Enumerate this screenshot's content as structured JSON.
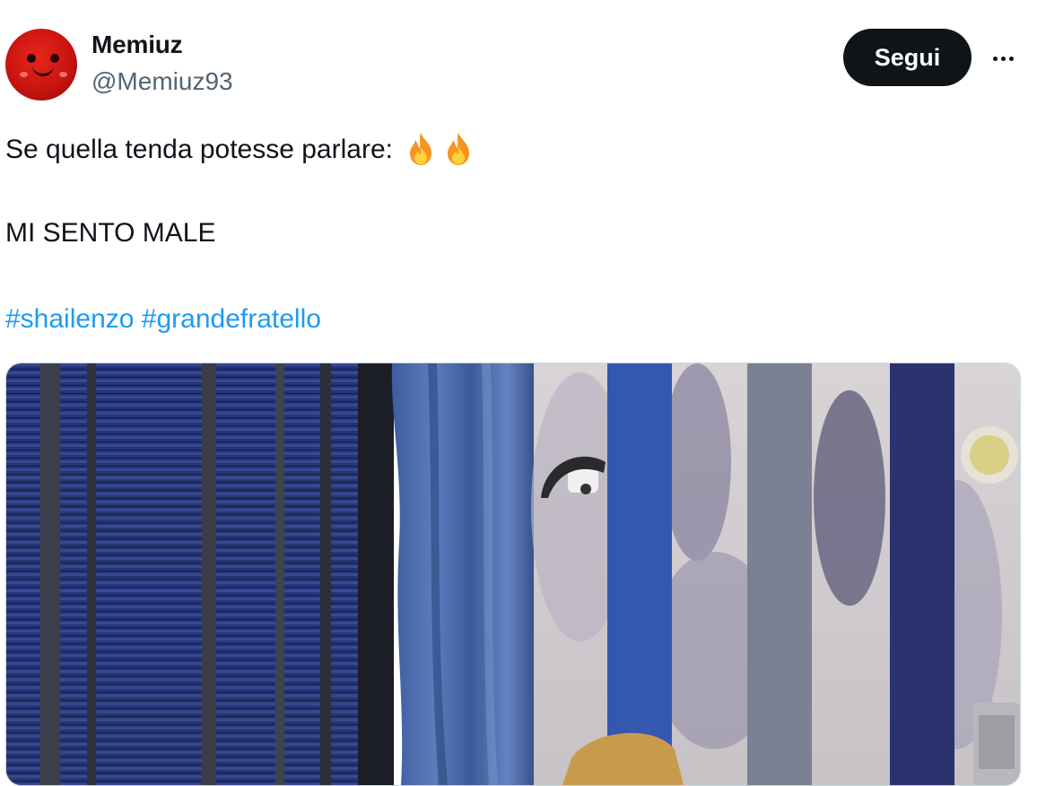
{
  "author": {
    "display_name": "Memiuz",
    "handle": "@Memiuz93",
    "avatar_icon": "red-smiley-avatar"
  },
  "actions": {
    "follow_label": "Segui",
    "more_icon": "more-horizontal-icon"
  },
  "tweet": {
    "line1": "Se quella tenda potesse parlare:",
    "emojis": [
      "fire-emoji",
      "fire-emoji"
    ],
    "line2": "MI SENTO MALE",
    "hashtags": [
      "#shailenzo",
      "#grandefratello"
    ]
  },
  "media": {
    "type": "video-frame",
    "icon": "video-thumbnail"
  },
  "colors": {
    "text": "#0f1419",
    "secondary": "#536471",
    "link": "#1d9bf0",
    "button_bg": "#0f1419",
    "border": "#cfd9de"
  }
}
